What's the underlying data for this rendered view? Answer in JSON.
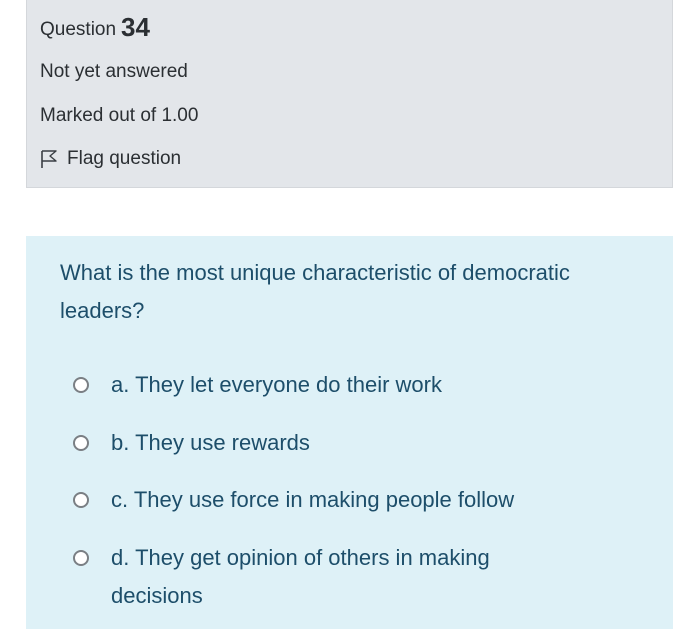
{
  "question_info": {
    "label": "Question",
    "number": "34",
    "state": "Not yet answered",
    "grade": "Marked out of 1.00",
    "flag_label": "Flag question"
  },
  "question": {
    "text": "What is the most unique characteristic of democratic leaders?",
    "options": [
      {
        "label": "a. They let everyone do their work",
        "selected": false
      },
      {
        "label": "b. They use rewards",
        "selected": false
      },
      {
        "label": "c. They use force in making people follow",
        "selected": false
      },
      {
        "label": "d. They get opinion of others in making decisions",
        "selected": false
      }
    ]
  },
  "colors": {
    "info_background": "#e3e6ea",
    "question_background": "#def1f7",
    "question_text": "#1d4e6a"
  }
}
